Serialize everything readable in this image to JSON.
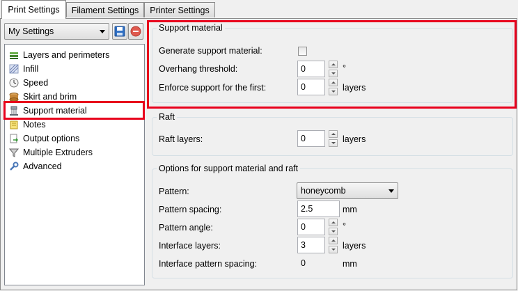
{
  "tabs": [
    {
      "label": "Print Settings",
      "active": true
    },
    {
      "label": "Filament Settings",
      "active": false
    },
    {
      "label": "Printer Settings",
      "active": false
    }
  ],
  "preset": {
    "selected": "My Settings"
  },
  "sidebar": {
    "items": [
      {
        "label": "Layers and perimeters",
        "icon": "layers-icon"
      },
      {
        "label": "Infill",
        "icon": "infill-icon"
      },
      {
        "label": "Speed",
        "icon": "speed-icon"
      },
      {
        "label": "Skirt and brim",
        "icon": "skirt-icon"
      },
      {
        "label": "Support material",
        "icon": "support-icon",
        "selected": true
      },
      {
        "label": "Notes",
        "icon": "notes-icon"
      },
      {
        "label": "Output options",
        "icon": "output-icon"
      },
      {
        "label": "Multiple Extruders",
        "icon": "funnel-icon"
      },
      {
        "label": "Advanced",
        "icon": "wrench-icon"
      }
    ]
  },
  "support": {
    "title": "Support material",
    "generate_label": "Generate support material:",
    "generate_checked": false,
    "overhang_label": "Overhang threshold:",
    "overhang_value": "0",
    "overhang_unit": "°",
    "enforce_label": "Enforce support for the first:",
    "enforce_value": "0",
    "enforce_unit": "layers"
  },
  "raft": {
    "title": "Raft",
    "layers_label": "Raft layers:",
    "layers_value": "0",
    "layers_unit": "layers"
  },
  "options": {
    "title": "Options for support material and raft",
    "pattern_label": "Pattern:",
    "pattern_value": "honeycomb",
    "spacing_label": "Pattern spacing:",
    "spacing_value": "2.5",
    "spacing_unit": "mm",
    "angle_label": "Pattern angle:",
    "angle_value": "0",
    "angle_unit": "°",
    "interface_label": "Interface layers:",
    "interface_value": "3",
    "interface_unit": "layers",
    "interface_spacing_label": "Interface pattern spacing:",
    "interface_spacing_value": "0",
    "interface_spacing_unit": "mm"
  },
  "colors": {
    "highlight": "#e8001c",
    "selection": "#3399ff"
  }
}
